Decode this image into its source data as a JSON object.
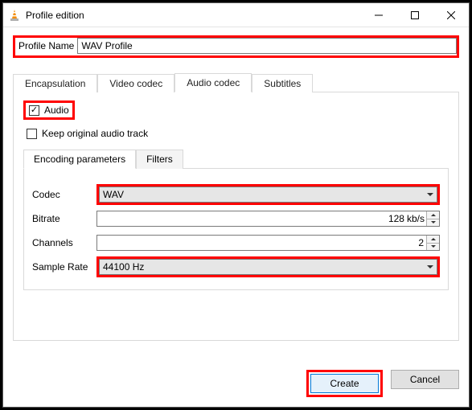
{
  "window": {
    "title": "Profile edition"
  },
  "profile": {
    "label": "Profile Name",
    "value": "WAV Profile"
  },
  "tabs": {
    "encapsulation": "Encapsulation",
    "video": "Video codec",
    "audio": "Audio codec",
    "subtitles": "Subtitles"
  },
  "audio_tab": {
    "audio_chk": "Audio",
    "keep_chk": "Keep original audio track",
    "inner_tabs": {
      "encoding": "Encoding parameters",
      "filters": "Filters"
    },
    "fields": {
      "codec_label": "Codec",
      "codec_value": "WAV",
      "bitrate_label": "Bitrate",
      "bitrate_value": "128",
      "bitrate_unit": "kb/s",
      "channels_label": "Channels",
      "channels_value": "2",
      "samplerate_label": "Sample Rate",
      "samplerate_value": "44100 Hz"
    }
  },
  "footer": {
    "create": "Create",
    "cancel": "Cancel"
  }
}
